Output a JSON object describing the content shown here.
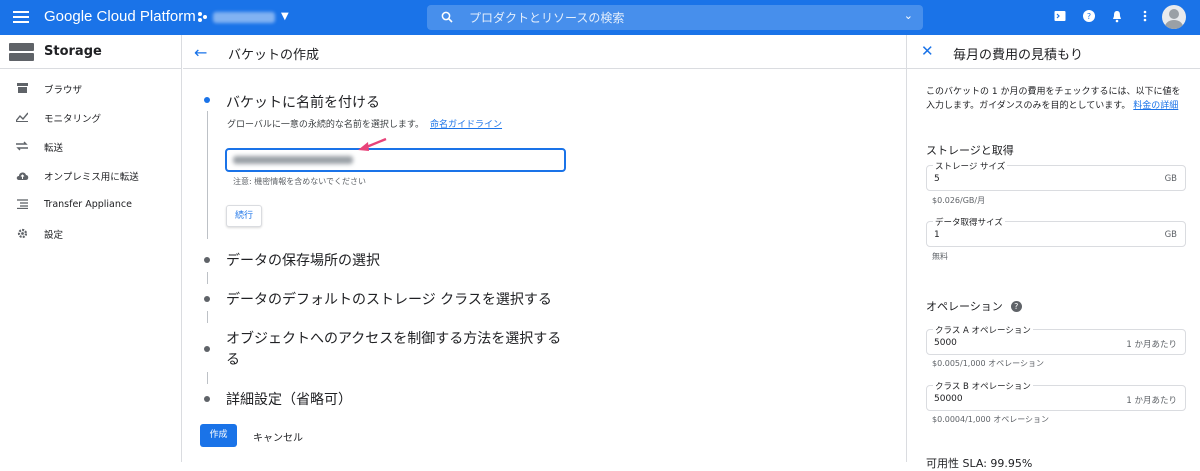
{
  "topbar": {
    "brand": "Google Cloud Platform",
    "search_placeholder": "プロダクトとリソースの検索"
  },
  "sidebar": {
    "title": "Storage",
    "items": [
      {
        "label": "ブラウザ",
        "icon": "browser-icon"
      },
      {
        "label": "モニタリング",
        "icon": "monitoring-icon"
      },
      {
        "label": "転送",
        "icon": "transfer-icon"
      },
      {
        "label": "オンプレミス用に転送",
        "icon": "cloud-upload-icon"
      },
      {
        "label": "Transfer Appliance",
        "icon": "appliance-icon"
      },
      {
        "label": "設定",
        "icon": "gear-icon"
      }
    ]
  },
  "center": {
    "title": "バケットの作成",
    "step1": {
      "title": "バケットに名前を付ける",
      "desc": "グローバルに一意の永続的な名前を選択します。",
      "link": "命名ガイドライン",
      "note": "注意: 機密情報を含めないでください",
      "continue": "続行"
    },
    "steps": [
      "データの保存場所の選択",
      "データのデフォルトのストレージ クラスを選択する",
      "オブジェクトへのアクセスを制御する方法を選択する",
      "る",
      "詳細設定（省略可）"
    ],
    "create": "作成",
    "cancel": "キャンセル"
  },
  "panel": {
    "title": "毎月の費用の見積もり",
    "intro": "このバケットの 1 か月の費用をチェックするには、以下に値を入力します。ガイダンスのみを目的としています。",
    "intro_link": "料金の詳細",
    "storage_section": "ストレージと取得",
    "storage_size": {
      "label": "ストレージ サイズ",
      "value": "5",
      "unit": "GB",
      "help": "$0.026/GB/月"
    },
    "retrieval_size": {
      "label": "データ取得サイズ",
      "value": "1",
      "unit": "GB",
      "help": "無料"
    },
    "ops_section": "オペレーション",
    "class_a": {
      "label": "クラス A オペレーション",
      "value": "5000",
      "unit": "1 か月あたり",
      "help": "$0.005/1,000 オペレーション"
    },
    "class_b": {
      "label": "クラス B オペレーション",
      "value": "50000",
      "unit": "1 か月あたり",
      "help": "$0.0004/1,000 オペレーション"
    },
    "sla": "可用性 SLA: 99.95%"
  },
  "colors": {
    "accent": "#1a73e8",
    "arrow": "#e8437a"
  }
}
